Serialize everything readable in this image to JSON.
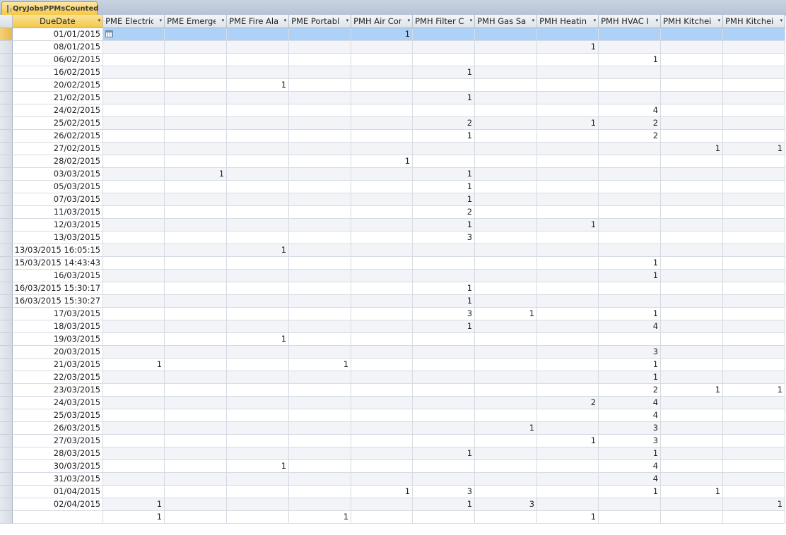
{
  "tab": {
    "label": "QryJobsPPMsCounted",
    "icon": "query-icon"
  },
  "columns": [
    "DueDate",
    "PME Electric",
    "PME Emerge",
    "PME Fire Ala",
    "PME Portabl",
    "PMH Air Cor",
    "PMH Filter C",
    "PMH Gas Saf",
    "PMH Heatin",
    "PMH HVAC I",
    "PMH Kitchei",
    "PMH Kitchei"
  ],
  "rows": [
    {
      "date": "01/01/2015",
      "cells": [
        "",
        "",
        "",
        "",
        "1",
        "",
        "",
        "",
        "",
        "",
        ""
      ]
    },
    {
      "date": "08/01/2015",
      "cells": [
        "",
        "",
        "",
        "",
        "",
        "",
        "",
        "1",
        "",
        "",
        ""
      ]
    },
    {
      "date": "06/02/2015",
      "cells": [
        "",
        "",
        "",
        "",
        "",
        "",
        "",
        "",
        "1",
        "",
        ""
      ]
    },
    {
      "date": "16/02/2015",
      "cells": [
        "",
        "",
        "",
        "",
        "",
        "1",
        "",
        "",
        "",
        "",
        ""
      ]
    },
    {
      "date": "20/02/2015",
      "cells": [
        "",
        "",
        "1",
        "",
        "",
        "",
        "",
        "",
        "",
        "",
        ""
      ]
    },
    {
      "date": "21/02/2015",
      "cells": [
        "",
        "",
        "",
        "",
        "",
        "1",
        "",
        "",
        "",
        "",
        ""
      ]
    },
    {
      "date": "24/02/2015",
      "cells": [
        "",
        "",
        "",
        "",
        "",
        "",
        "",
        "",
        "4",
        "",
        ""
      ]
    },
    {
      "date": "25/02/2015",
      "cells": [
        "",
        "",
        "",
        "",
        "",
        "2",
        "",
        "1",
        "2",
        "",
        ""
      ]
    },
    {
      "date": "26/02/2015",
      "cells": [
        "",
        "",
        "",
        "",
        "",
        "1",
        "",
        "",
        "2",
        "",
        ""
      ]
    },
    {
      "date": "27/02/2015",
      "cells": [
        "",
        "",
        "",
        "",
        "",
        "",
        "",
        "",
        "",
        "1",
        "1"
      ]
    },
    {
      "date": "28/02/2015",
      "cells": [
        "",
        "",
        "",
        "",
        "1",
        "",
        "",
        "",
        "",
        "",
        ""
      ]
    },
    {
      "date": "03/03/2015",
      "cells": [
        "",
        "1",
        "",
        "",
        "",
        "1",
        "",
        "",
        "",
        "",
        ""
      ]
    },
    {
      "date": "05/03/2015",
      "cells": [
        "",
        "",
        "",
        "",
        "",
        "1",
        "",
        "",
        "",
        "",
        ""
      ]
    },
    {
      "date": "07/03/2015",
      "cells": [
        "",
        "",
        "",
        "",
        "",
        "1",
        "",
        "",
        "",
        "",
        ""
      ]
    },
    {
      "date": "11/03/2015",
      "cells": [
        "",
        "",
        "",
        "",
        "",
        "2",
        "",
        "",
        "",
        "",
        ""
      ]
    },
    {
      "date": "12/03/2015",
      "cells": [
        "",
        "",
        "",
        "",
        "",
        "1",
        "",
        "1",
        "",
        "",
        ""
      ]
    },
    {
      "date": "13/03/2015",
      "cells": [
        "",
        "",
        "",
        "",
        "",
        "3",
        "",
        "",
        "",
        "",
        ""
      ]
    },
    {
      "date": "13/03/2015 16:05:15",
      "cells": [
        "",
        "",
        "1",
        "",
        "",
        "",
        "",
        "",
        "",
        "",
        ""
      ]
    },
    {
      "date": "15/03/2015 14:43:43",
      "cells": [
        "",
        "",
        "",
        "",
        "",
        "",
        "",
        "",
        "1",
        "",
        ""
      ]
    },
    {
      "date": "16/03/2015",
      "cells": [
        "",
        "",
        "",
        "",
        "",
        "",
        "",
        "",
        "1",
        "",
        ""
      ]
    },
    {
      "date": "16/03/2015 15:30:17",
      "cells": [
        "",
        "",
        "",
        "",
        "",
        "1",
        "",
        "",
        "",
        "",
        ""
      ]
    },
    {
      "date": "16/03/2015 15:30:27",
      "cells": [
        "",
        "",
        "",
        "",
        "",
        "1",
        "",
        "",
        "",
        "",
        ""
      ]
    },
    {
      "date": "17/03/2015",
      "cells": [
        "",
        "",
        "",
        "",
        "",
        "3",
        "1",
        "",
        "1",
        "",
        ""
      ]
    },
    {
      "date": "18/03/2015",
      "cells": [
        "",
        "",
        "",
        "",
        "",
        "1",
        "",
        "",
        "4",
        "",
        ""
      ]
    },
    {
      "date": "19/03/2015",
      "cells": [
        "",
        "",
        "1",
        "",
        "",
        "",
        "",
        "",
        "",
        "",
        ""
      ]
    },
    {
      "date": "20/03/2015",
      "cells": [
        "",
        "",
        "",
        "",
        "",
        "",
        "",
        "",
        "3",
        "",
        ""
      ]
    },
    {
      "date": "21/03/2015",
      "cells": [
        "1",
        "",
        "",
        "1",
        "",
        "",
        "",
        "",
        "1",
        "",
        ""
      ]
    },
    {
      "date": "22/03/2015",
      "cells": [
        "",
        "",
        "",
        "",
        "",
        "",
        "",
        "",
        "1",
        "",
        ""
      ]
    },
    {
      "date": "23/03/2015",
      "cells": [
        "",
        "",
        "",
        "",
        "",
        "",
        "",
        "",
        "2",
        "1",
        "1"
      ]
    },
    {
      "date": "24/03/2015",
      "cells": [
        "",
        "",
        "",
        "",
        "",
        "",
        "",
        "2",
        "4",
        "",
        ""
      ]
    },
    {
      "date": "25/03/2015",
      "cells": [
        "",
        "",
        "",
        "",
        "",
        "",
        "",
        "",
        "4",
        "",
        ""
      ]
    },
    {
      "date": "26/03/2015",
      "cells": [
        "",
        "",
        "",
        "",
        "",
        "",
        "1",
        "",
        "3",
        "",
        ""
      ]
    },
    {
      "date": "27/03/2015",
      "cells": [
        "",
        "",
        "",
        "",
        "",
        "",
        "",
        "1",
        "3",
        "",
        ""
      ]
    },
    {
      "date": "28/03/2015",
      "cells": [
        "",
        "",
        "",
        "",
        "",
        "1",
        "",
        "",
        "1",
        "",
        ""
      ]
    },
    {
      "date": "30/03/2015",
      "cells": [
        "",
        "",
        "1",
        "",
        "",
        "",
        "",
        "",
        "4",
        "",
        ""
      ]
    },
    {
      "date": "31/03/2015",
      "cells": [
        "",
        "",
        "",
        "",
        "",
        "",
        "",
        "",
        "4",
        "",
        ""
      ]
    },
    {
      "date": "01/04/2015",
      "cells": [
        "",
        "",
        "",
        "",
        "1",
        "3",
        "",
        "",
        "1",
        "1",
        ""
      ]
    },
    {
      "date": "02/04/2015",
      "cells": [
        "1",
        "",
        "",
        "",
        "",
        "1",
        "3",
        "",
        "",
        "",
        "1"
      ]
    },
    {
      "date": "",
      "cells": [
        "1",
        "",
        "",
        "1",
        "",
        "",
        "",
        "1",
        "",
        "",
        ""
      ]
    }
  ],
  "active_row": 0,
  "colors": {
    "active_row": "#aed1f7",
    "date_header": "#f3c749",
    "tab": "#f5c748"
  }
}
